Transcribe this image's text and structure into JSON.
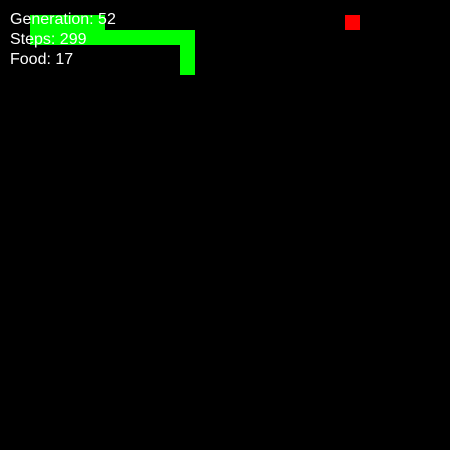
{
  "game": {
    "board_background": "#000000",
    "snake_color": "#00ff00",
    "food_color": "#ff0000",
    "snake": [
      {
        "col": 12,
        "row": 4
      },
      {
        "col": 12,
        "row": 3
      },
      {
        "col": 12,
        "row": 2
      },
      {
        "col": 11,
        "row": 2
      },
      {
        "col": 10,
        "row": 2
      },
      {
        "col": 9,
        "row": 2
      },
      {
        "col": 8,
        "row": 2
      },
      {
        "col": 7,
        "row": 2
      },
      {
        "col": 6,
        "row": 2
      },
      {
        "col": 5,
        "row": 2
      },
      {
        "col": 4,
        "row": 2
      },
      {
        "col": 3,
        "row": 2
      },
      {
        "col": 2,
        "row": 2
      },
      {
        "col": 2,
        "row": 1
      },
      {
        "col": 3,
        "row": 1
      },
      {
        "col": 4,
        "row": 1
      },
      {
        "col": 5,
        "row": 1
      },
      {
        "col": 6,
        "row": 1
      }
    ],
    "food": {
      "col": 23,
      "row": 1
    }
  },
  "hud": {
    "generation_label": "Generation: 52",
    "steps_label": "Steps: 299",
    "food_label": "Food: 17"
  }
}
